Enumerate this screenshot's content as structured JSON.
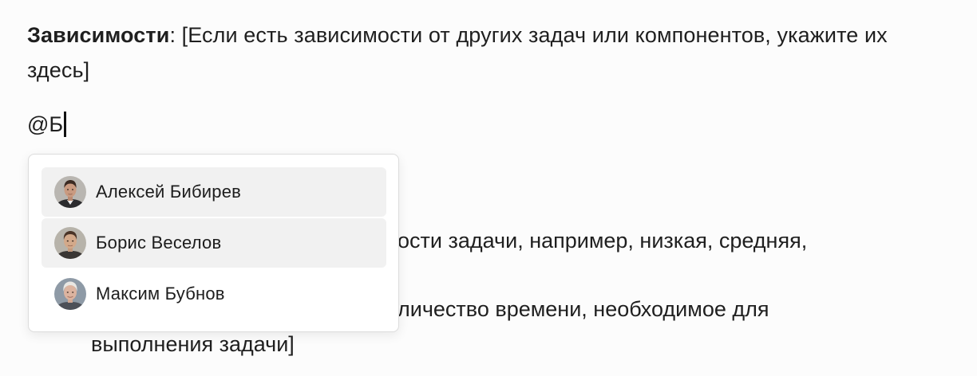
{
  "document": {
    "dependencies_label": "Зависимости",
    "dependencies_text": ": [Если есть зависимости от других задач или компонентов, укажите их здесь]",
    "mention_input": "@Б",
    "hidden_line_1": "ости задачи, например, низкая, средняя,",
    "hidden_line_2": "личество времени, необходимое для",
    "hidden_line_3": "выполнения задачи]"
  },
  "mention_dropdown": {
    "options": [
      {
        "name": "Алексей Бибирев",
        "avatar": "avatar-aleksey"
      },
      {
        "name": "Борис Веселов",
        "avatar": "avatar-boris"
      },
      {
        "name": "Максим Бубнов",
        "avatar": "avatar-maksim"
      }
    ]
  }
}
